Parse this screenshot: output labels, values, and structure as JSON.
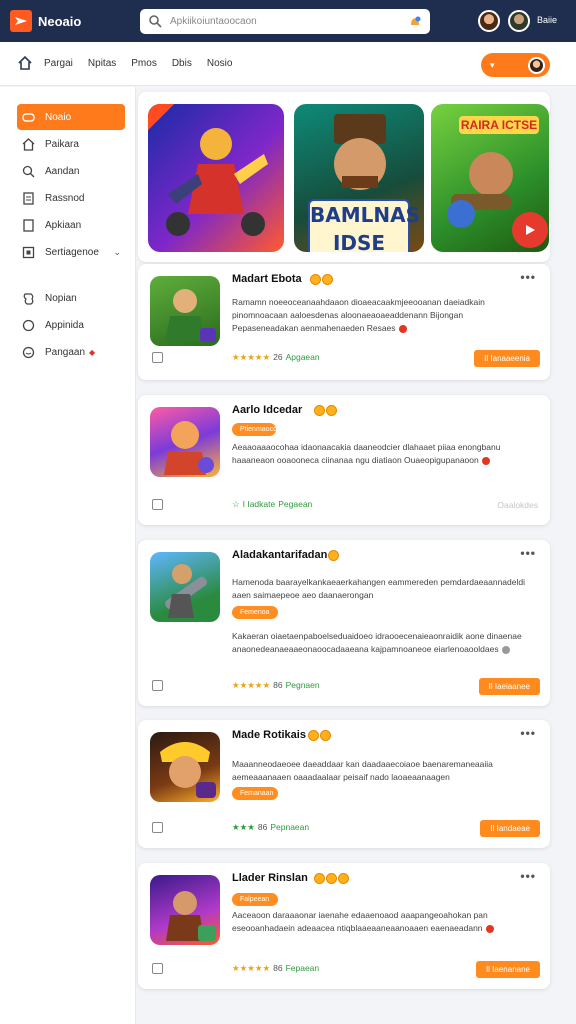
{
  "app": {
    "logo_text": "Neoaio",
    "search_placeholder": "Apkiikoiuntaoocaon",
    "top_user_label": "Baiie"
  },
  "nav": {
    "links": [
      "Pargai",
      "Npitas",
      "Pmos",
      "Dbis",
      "Nosio"
    ]
  },
  "sidebar": {
    "items": [
      {
        "label": "Noaio",
        "icon": "game-icon",
        "active": true
      },
      {
        "label": "Paikara",
        "icon": "home-icon"
      },
      {
        "label": "Aandan",
        "icon": "search-icon"
      },
      {
        "label": "Rassnod",
        "icon": "document-icon"
      },
      {
        "label": "Apkiaan",
        "icon": "bookmark-icon"
      },
      {
        "label": "Sertiagenoe",
        "icon": "settings-icon",
        "caret": "⌄"
      },
      {
        "label": "Nopian",
        "icon": "puzzle-icon"
      },
      {
        "label": "Appinida",
        "icon": "circle-icon"
      },
      {
        "label": "Pangaan",
        "icon": "gift-icon",
        "badge": "◆"
      }
    ]
  },
  "hero": {
    "banner_text": "BAMLNAS IDSE",
    "banner_top_text": "RAIRA ICTSE"
  },
  "cards": [
    {
      "title": "Madart Ebota",
      "desc": "Ramamn noeeoceanaahdaaon dioaeacaakmjeeooanan daeiadkain pinomnoacaan aaloesdenas aloonaeaoaeaddenann Bijongan Pepaseneadakan aenmahenaeden Resaes",
      "rating_stars": "★★★★★",
      "rating_num": "26",
      "rating_text": "Apgaean",
      "action": "Il Ianaaeenia"
    },
    {
      "title": "Aarlo Idcedar",
      "tag": "Ptienmaocdnaan",
      "desc": "Aeaaoaaaocohaa idaonaacakia daaneodcier dlahaaet piiaa enongbanu haaaneaon ooaooneca ciinanaa ngu diatiaon Ouaeopigupanaoon",
      "rating_stars": "☆",
      "rating_num": "I  Iadkate",
      "rating_text": "Pegaean",
      "action_ghost": "Oaalokdes"
    },
    {
      "title": "Aladakantarifadan",
      "tag": "Femenoa",
      "desc_top": "Hamenoda baarayelkankaeaerkahangen eammereden pemdardaeaannadeldi aaen saimaepeoe aeo daanaerongan",
      "desc": "Kakaeran oiaetaenpaboelseduaidoeo idraooecenaieaonraidik aone dinaenae anaonedeanaeaaeonaoocadaaeana kajpamnoaneoe eiarlenoaooldaes",
      "rating_stars": "★★★★★",
      "rating_num": "86",
      "rating_text": "Pegnaen",
      "action": "Il Iaeiaanee"
    },
    {
      "title": "Made Rotikais",
      "tag": "Femanaan",
      "desc": "Maaanneodaeoee daeaddaar kan daadaaecoiaoe baenaremaneaaiia aemeaaanaaen oaaadaalaar peisaif nado laoaeaanaagen",
      "rating_stars": "★★★",
      "rating_num": "86",
      "rating_text": "Pepnaean",
      "action": "Il Iandaeae"
    },
    {
      "title": "Llader Rinslan",
      "tag": "Falpeean",
      "desc": "Aaceaoon daraaaonar iaenahe edaaenoaod aaapangeoahokan pan eseooanhadaein adeaacea ntiqblaaeaaneaanoaaen eaenaeadann",
      "rating_stars": "★★★★★",
      "rating_num": "86",
      "rating_text": "Fepaean",
      "action": "Il Iaenanane"
    }
  ],
  "colors": {
    "accent": "#ff7a1a",
    "topbar": "#1f2e4f"
  }
}
